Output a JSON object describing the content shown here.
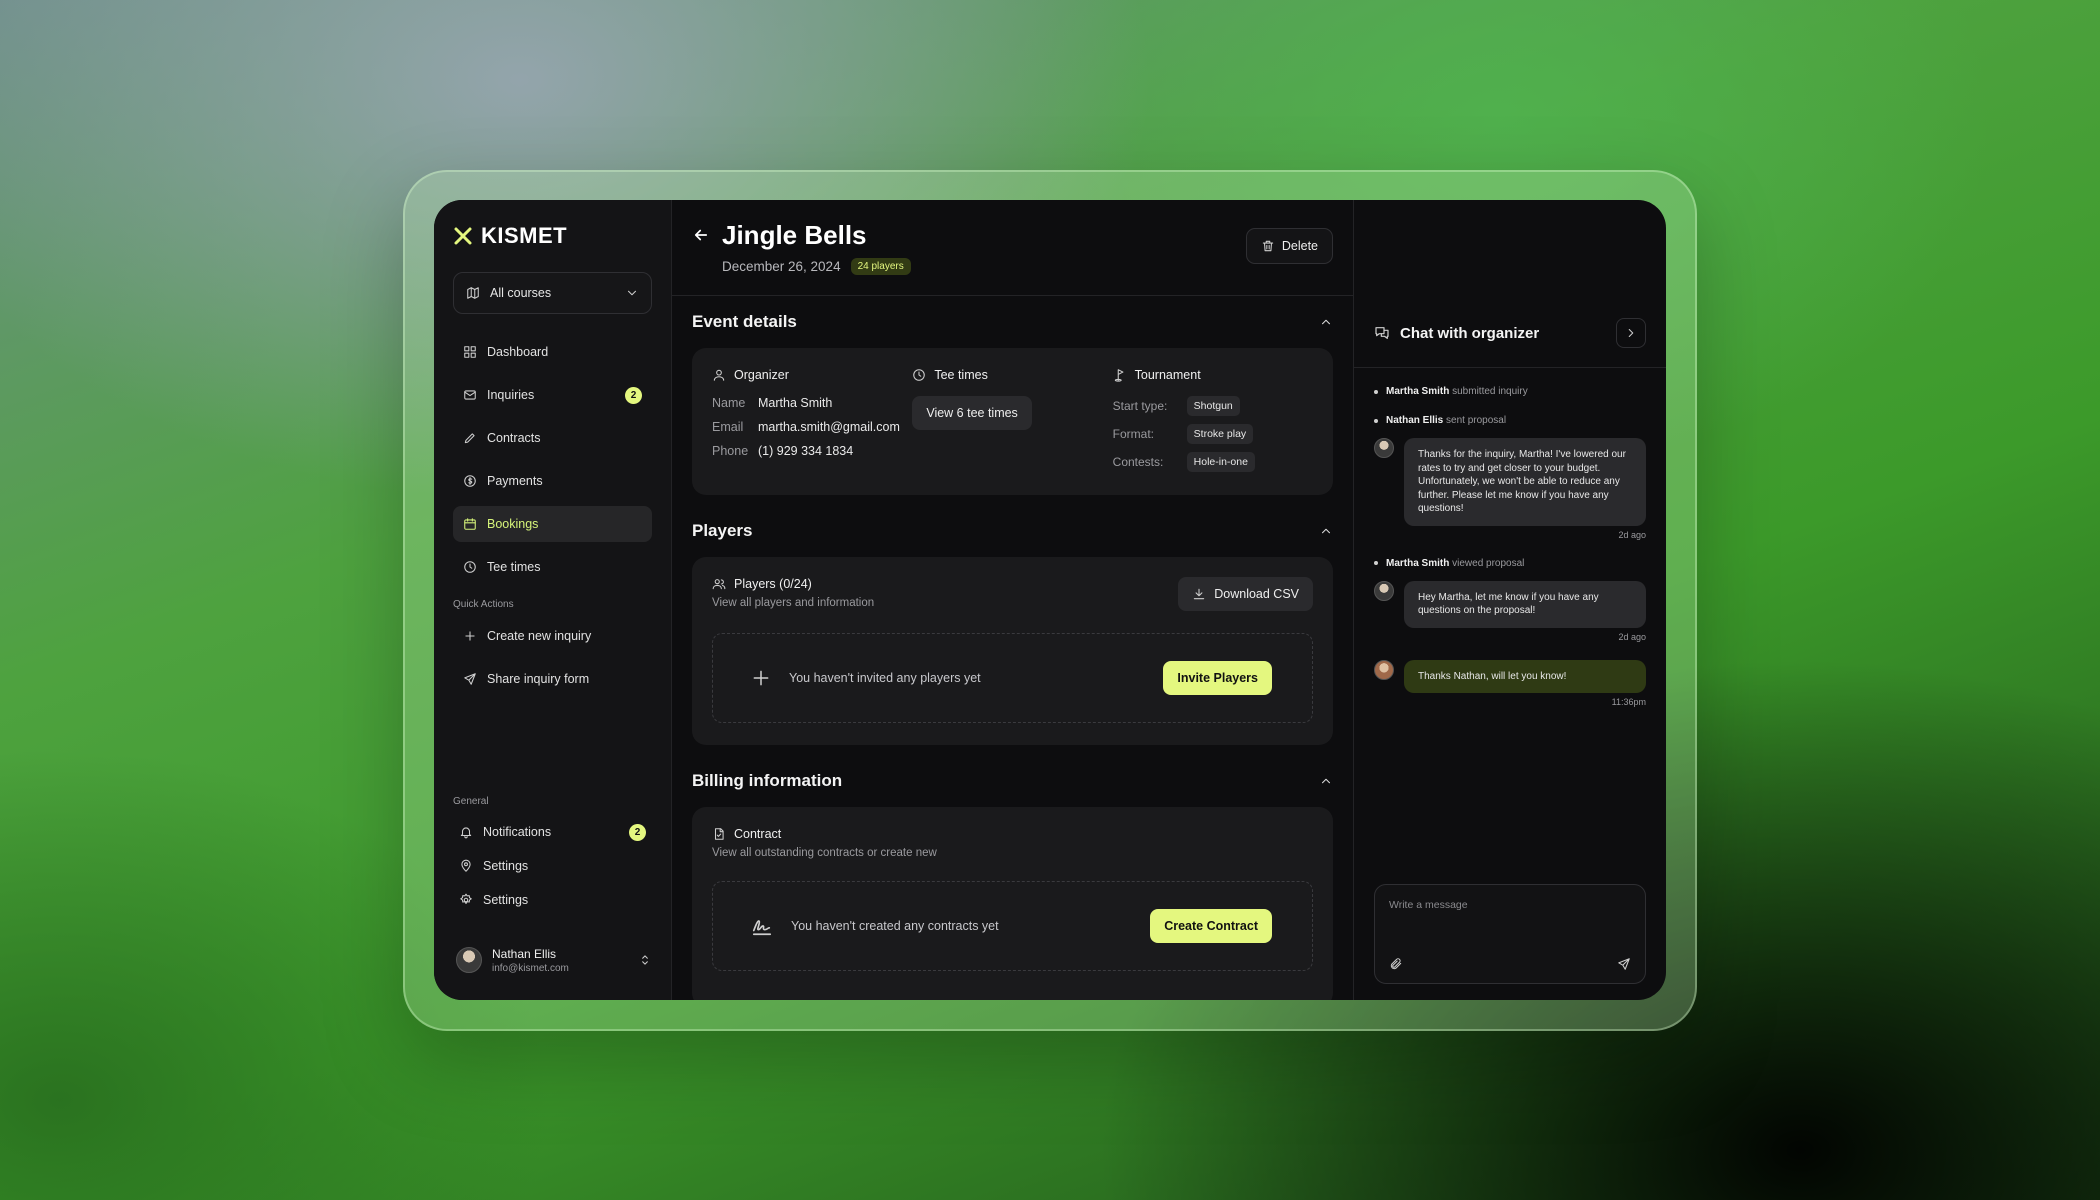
{
  "brand": {
    "name": "KISMET"
  },
  "course_select": {
    "label": "All courses"
  },
  "nav": [
    {
      "label": "Dashboard",
      "icon": "grid-icon"
    },
    {
      "label": "Inquiries",
      "icon": "mail-icon",
      "badge": "2"
    },
    {
      "label": "Contracts",
      "icon": "pen-icon"
    },
    {
      "label": "Payments",
      "icon": "dollar-icon"
    },
    {
      "label": "Bookings",
      "icon": "calendar-icon",
      "active": true
    },
    {
      "label": "Tee times",
      "icon": "clock-icon"
    }
  ],
  "quick_actions": {
    "label": "Quick Actions",
    "items": [
      {
        "label": "Create new inquiry",
        "icon": "plus-icon"
      },
      {
        "label": "Share inquiry form",
        "icon": "send-icon"
      }
    ]
  },
  "general": {
    "label": "General",
    "items": [
      {
        "label": "Notifications",
        "icon": "bell-icon",
        "badge": "2"
      },
      {
        "label": "Settings",
        "icon": "pin-icon"
      },
      {
        "label": "Settings",
        "icon": "gear-icon"
      }
    ]
  },
  "user": {
    "name": "Nathan Ellis",
    "email": "info@kismet.com"
  },
  "header": {
    "title": "Jingle Bells",
    "date": "December 26, 2024",
    "players_badge": "24 players",
    "delete_label": "Delete"
  },
  "event_details": {
    "heading": "Event details",
    "organizer": {
      "title": "Organizer",
      "fields": [
        {
          "k": "Name",
          "v": "Martha Smith"
        },
        {
          "k": "Email",
          "v": "martha.smith@gmail.com"
        },
        {
          "k": "Phone",
          "v": "(1) 929 334 1834"
        }
      ]
    },
    "tee_times": {
      "title": "Tee times",
      "button": "View 6 tee times"
    },
    "tournament": {
      "title": "Tournament",
      "fields": [
        {
          "k": "Start type:",
          "v": "Shotgun"
        },
        {
          "k": "Format:",
          "v": "Stroke play"
        },
        {
          "k": "Contests:",
          "v": "Hole-in-one"
        }
      ]
    }
  },
  "players": {
    "heading": "Players",
    "title": "Players (0/24)",
    "subtitle": "View all players and information",
    "download_label": "Download CSV",
    "empty_text": "You haven't invited any players yet",
    "invite_label": "Invite Players"
  },
  "billing": {
    "heading": "Billing information",
    "title": "Contract",
    "subtitle": "View all outstanding contracts or create new",
    "empty_text": "You haven't created any contracts yet",
    "create_label": "Create Contract"
  },
  "chat": {
    "title": "Chat with organizer",
    "events": [
      {
        "who": "Martha Smith",
        "what": "submitted inquiry"
      },
      {
        "who": "Nathan Ellis",
        "what": "sent proposal"
      },
      {
        "who": "Martha Smith",
        "what": "viewed proposal"
      }
    ],
    "messages": [
      {
        "text": "Thanks for the inquiry, Martha! I've lowered our rates to try and get closer to your budget. Unfortunately, we won't be able to reduce any further. Please let me know if you have any questions!",
        "time": "2d ago"
      },
      {
        "text": "Hey Martha, let me know if you have any questions on the proposal!",
        "time": "2d ago"
      },
      {
        "text": "Thanks Nathan, will let you know!",
        "time": "11:36pm"
      }
    ],
    "composer_placeholder": "Write a message"
  },
  "colors": {
    "accent": "#e4f77f",
    "background": "#0d0d0f"
  }
}
